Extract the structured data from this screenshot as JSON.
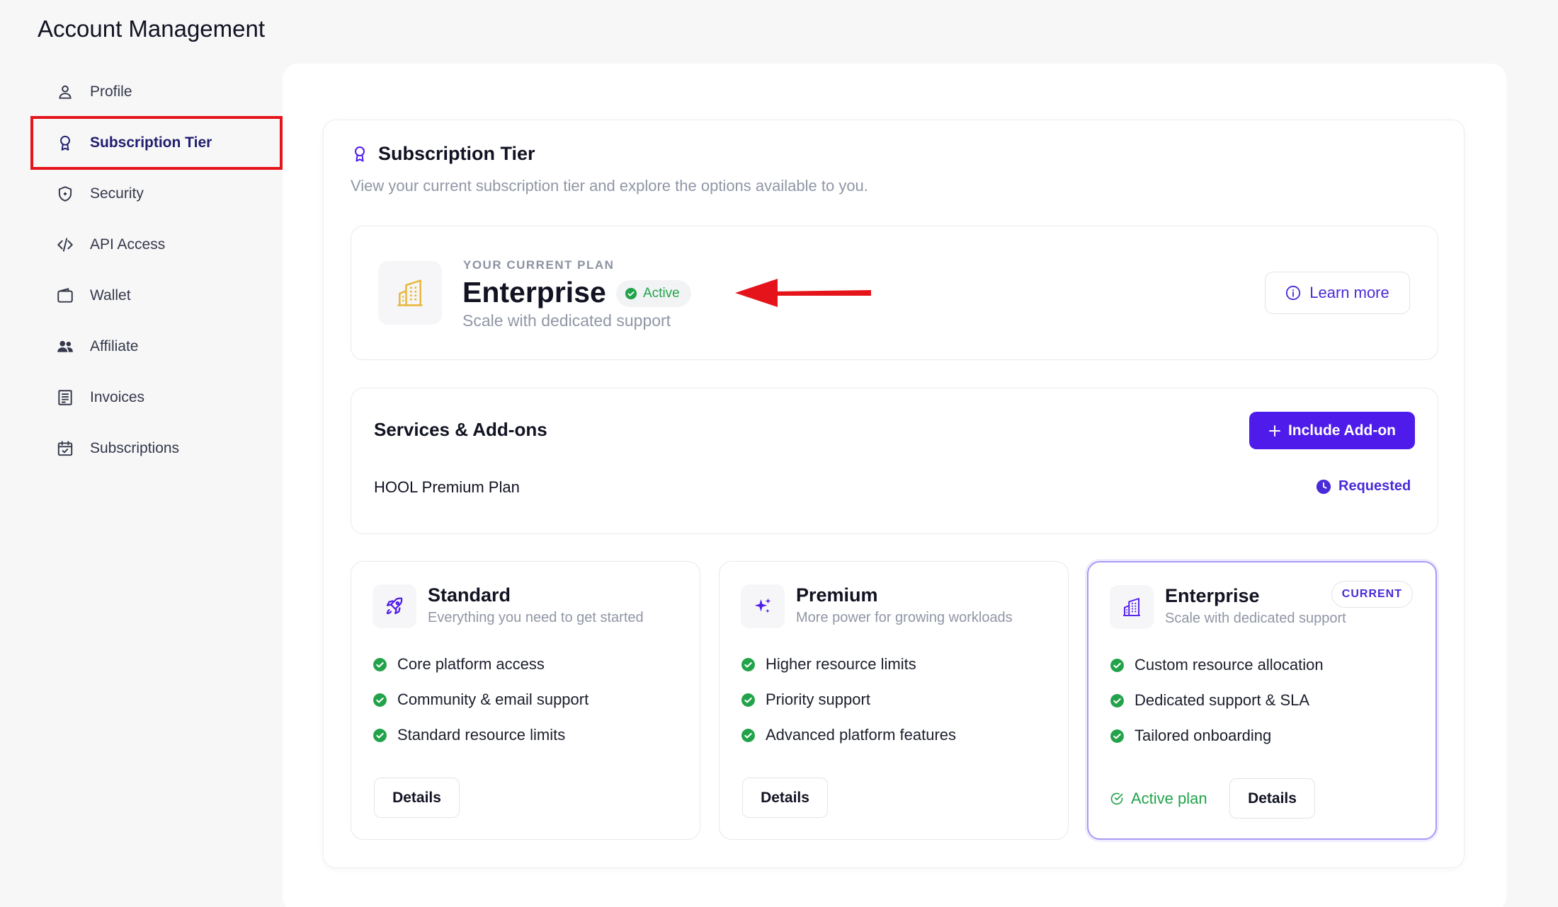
{
  "page": {
    "title": "Account Management"
  },
  "sidebar": {
    "items": [
      {
        "label": "Profile",
        "icon": "user-icon"
      },
      {
        "label": "Subscription Tier",
        "icon": "award-icon",
        "active": true
      },
      {
        "label": "Security",
        "icon": "shield-icon"
      },
      {
        "label": "API Access",
        "icon": "code-icon"
      },
      {
        "label": "Wallet",
        "icon": "wallet-icon"
      },
      {
        "label": "Affiliate",
        "icon": "users-icon"
      },
      {
        "label": "Invoices",
        "icon": "receipt-icon"
      },
      {
        "label": "Subscriptions",
        "icon": "calendar-check-icon"
      }
    ]
  },
  "section": {
    "title": "Subscription Tier",
    "subtitle": "View your current subscription tier and explore the options available to you."
  },
  "current_plan": {
    "eyebrow": "YOUR CURRENT PLAN",
    "name": "Enterprise",
    "status": "Active",
    "description": "Scale with dedicated support",
    "learn_more": "Learn more"
  },
  "services": {
    "title": "Services & Add-ons",
    "add_button": "Include Add-on",
    "items": [
      {
        "name": "HOOL Premium Plan",
        "status": "Requested"
      }
    ]
  },
  "tiers": [
    {
      "name": "Standard",
      "description": "Everything you need to get started",
      "features": [
        "Core platform access",
        "Community & email support",
        "Standard resource limits"
      ],
      "details": "Details"
    },
    {
      "name": "Premium",
      "description": "More power for growing workloads",
      "features": [
        "Higher resource limits",
        "Priority support",
        "Advanced platform features"
      ],
      "details": "Details"
    },
    {
      "name": "Enterprise",
      "description": "Scale with dedicated support",
      "badge": "CURRENT",
      "features": [
        "Custom resource allocation",
        "Dedicated support & SLA",
        "Tailored onboarding"
      ],
      "active_label": "Active plan",
      "details": "Details"
    }
  ],
  "colors": {
    "accent": "#4f1bea",
    "success": "#22a34a",
    "highlight": "#e5141a",
    "enterprise_icon": "#e9b83d"
  }
}
